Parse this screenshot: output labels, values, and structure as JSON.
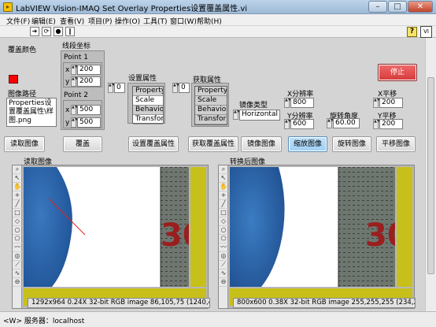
{
  "window": {
    "title": "LabVIEW Vision-IMAQ Set Overlay Properties设置覆盖属性.vi",
    "minimize": "–",
    "maximize": "□",
    "close": "✕"
  },
  "menu": [
    "文件(F)",
    "编辑(E)",
    "查看(V)",
    "项目(P)",
    "操作(O)",
    "工具(T)",
    "窗口(W)",
    "帮助(H)"
  ],
  "toolbar": {
    "run": "➜",
    "run_continuous": "⟳",
    "abort": "●",
    "pause": "‖",
    "help": "?",
    "vi_icon": "VI"
  },
  "overlay_color": {
    "label": "覆盖颜色",
    "color": "#ff0000"
  },
  "image_path": {
    "label": "图像路径",
    "value": "Properties设置覆盖属性\\样图.png"
  },
  "line_coords": {
    "label": "线段坐标",
    "point1": {
      "label": "Point 1",
      "x_label": "x",
      "x": "200",
      "y_label": "y",
      "y": "200"
    },
    "point2": {
      "label": "Point 2",
      "x_label": "x",
      "x": "500",
      "y_label": "y",
      "y": "500"
    }
  },
  "set_props": {
    "label": "设置属性",
    "index": "0",
    "rows": [
      "Property",
      "Scale",
      "Behavior",
      "Transfor"
    ]
  },
  "get_props": {
    "label": "获取属性",
    "index": "0",
    "rows": [
      "Property",
      "Scale",
      "Behavior",
      "Transfor"
    ]
  },
  "mirror_type": {
    "label": "镜像类型",
    "value": "Horizontal"
  },
  "x_res": {
    "label": "X分辨率",
    "value": "800"
  },
  "y_res": {
    "label": "Y分辨率",
    "value": "600"
  },
  "rotate_angle": {
    "label": "旋转角度",
    "value": "60.00"
  },
  "x_shift": {
    "label": "X平移",
    "value": "200"
  },
  "y_shift": {
    "label": "Y平移",
    "value": "200"
  },
  "buttons": {
    "stop": "停止",
    "read_image": "读取图像",
    "overlay": "覆盖",
    "set_overlay_props": "设置覆盖属性",
    "get_overlay_props": "获取覆盖属性",
    "mirror": "镜像图像",
    "zoom": "缩放图像",
    "rotate": "旋转图像",
    "translate": "平移图像"
  },
  "left_display": {
    "label": "读取图像",
    "info": "1292x964 0.24X 32-bit RGB image 86,105,75    (1240,41)",
    "ruler_number": "30"
  },
  "right_display": {
    "label": "转换后图像",
    "info": "800x600 0.38X 32-bit RGB image 255,255,255    (234,29)",
    "ruler_number": "30"
  },
  "palette_tools": [
    "zoom-tool",
    "pointer-tool",
    "pan-tool",
    "point-tool",
    "line-tool",
    "rect-tool",
    "rotated-rect-tool",
    "oval-tool",
    "polygon-tool",
    "freehand-tool",
    "annulus-tool",
    "broken-line-tool",
    "freehand-line-tool",
    "zoom-out-tool"
  ],
  "status": "<W> 服务器：localhost"
}
